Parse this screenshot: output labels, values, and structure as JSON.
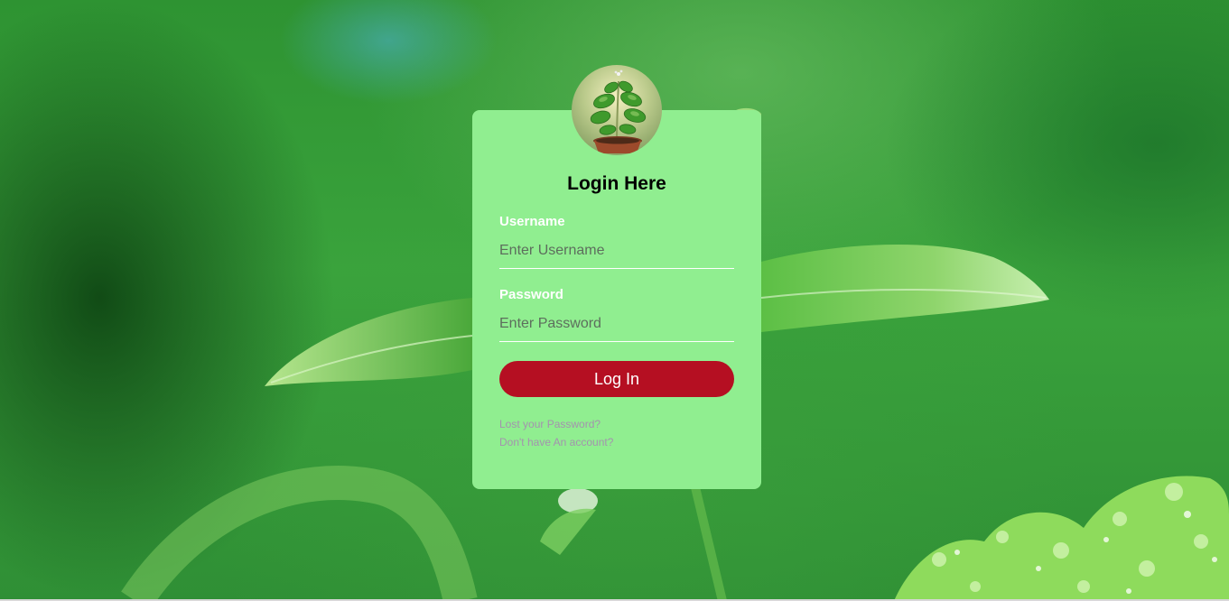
{
  "colors": {
    "card_bg": "#90ee90",
    "button_bg": "#b50f22",
    "link_color": "#a493ae",
    "label_color": "#ffffff"
  },
  "background": {
    "icon": "green-leaf-background-image"
  },
  "avatar": {
    "icon": "potted-plant-icon"
  },
  "form": {
    "title": "Login Here",
    "username": {
      "label": "Username",
      "placeholder": "Enter Username",
      "value": ""
    },
    "password": {
      "label": "Password",
      "placeholder": "Enter Password",
      "value": ""
    },
    "submit_label": "Log In",
    "lost_password_link": "Lost your Password?",
    "signup_link": "Don't have An account?"
  }
}
